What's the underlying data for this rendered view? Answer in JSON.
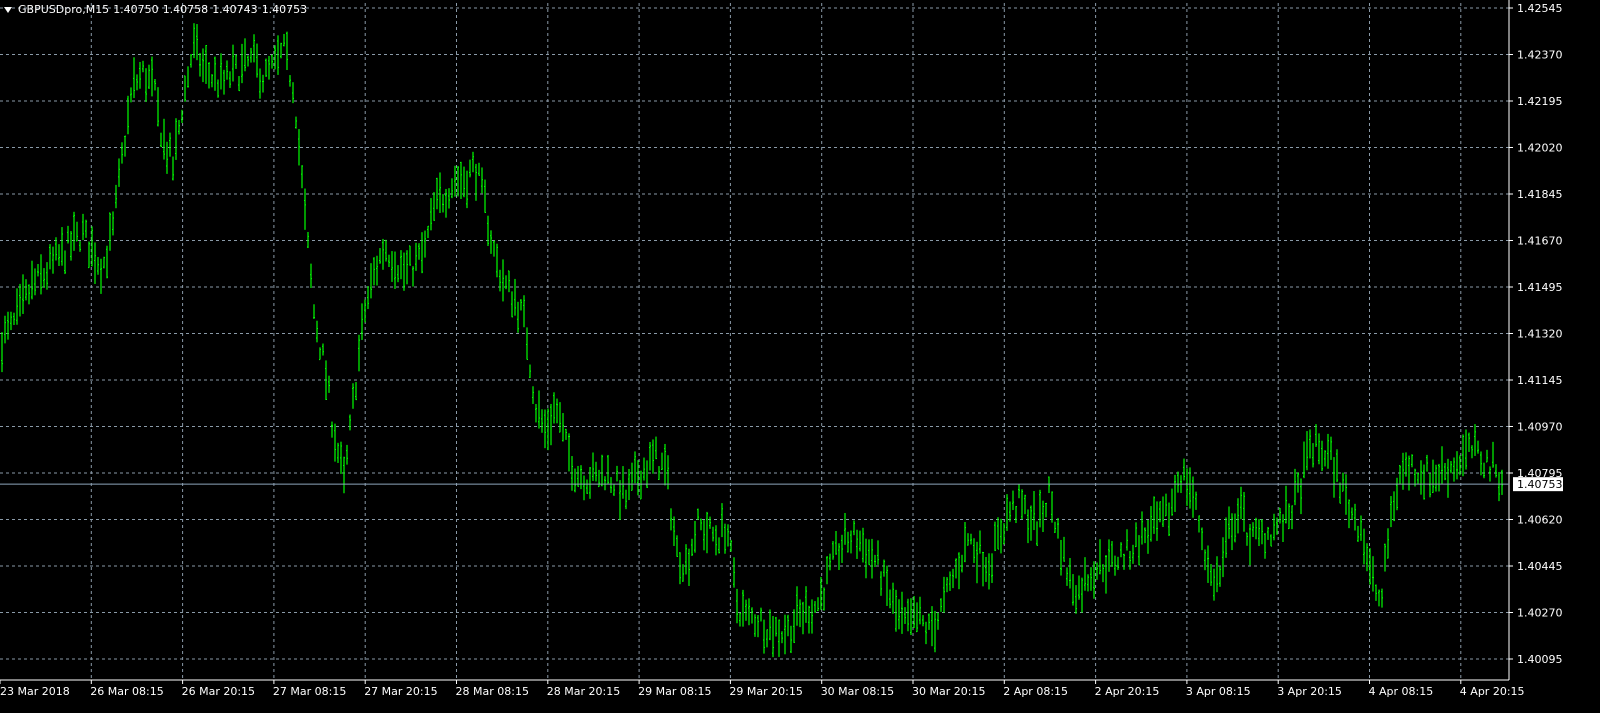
{
  "header": {
    "symbol": "GBPUSDpro,M15",
    "open": "1.40750",
    "high": "1.40758",
    "low": "1.40743",
    "close": "1.40753"
  },
  "colors": {
    "background": "#000000",
    "bars": "#00ff00",
    "grid": "#8a9aa8",
    "axis": "#ffffff",
    "text": "#ffffff",
    "price_line": "#8ea6bd",
    "price_label_bg": "#ffffff",
    "price_label_text": "#000000"
  },
  "current_price": "1.40753",
  "chart_data": {
    "type": "bar",
    "title": "GBPUSDpro,M15",
    "grid": true,
    "y_ticks": [
      "1.42545",
      "1.42370",
      "1.42195",
      "1.42020",
      "1.41845",
      "1.41670",
      "1.41495",
      "1.41320",
      "1.41145",
      "1.40970",
      "1.40795",
      "1.40620",
      "1.40445",
      "1.40270",
      "1.40095"
    ],
    "x_ticks": [
      "23 Mar 2018",
      "26 Mar 08:15",
      "26 Mar 20:15",
      "27 Mar 08:15",
      "27 Mar 20:15",
      "28 Mar 08:15",
      "28 Mar 20:15",
      "29 Mar 08:15",
      "29 Mar 20:15",
      "30 Mar 08:15",
      "30 Mar 20:15",
      "2 Apr 08:15",
      "2 Apr 20:15",
      "3 Apr 08:15",
      "3 Apr 20:15",
      "4 Apr 08:15",
      "4 Apr 20:15"
    ],
    "ylim": [
      1.40095,
      1.42545
    ],
    "series": [
      {
        "values": [
          1.413,
          1.4134,
          1.4142,
          1.415,
          1.4153,
          1.4158,
          1.4162,
          1.4166,
          1.417,
          1.4163,
          1.4157,
          1.417,
          1.42,
          1.4225,
          1.423,
          1.4225,
          1.4205,
          1.4195,
          1.422,
          1.424,
          1.4232,
          1.4228,
          1.4226,
          1.423,
          1.4232,
          1.4235,
          1.4228,
          1.4232,
          1.4238,
          1.4225,
          1.418,
          1.414,
          1.412,
          1.4095,
          1.4075,
          1.411,
          1.414,
          1.4155,
          1.4165,
          1.416,
          1.4155,
          1.4158,
          1.4163,
          1.418,
          1.4185,
          1.419,
          1.419,
          1.4195,
          1.418,
          1.416,
          1.415,
          1.4145,
          1.4135,
          1.4105,
          1.4095,
          1.4105,
          1.409,
          1.408,
          1.4078,
          1.4078,
          1.408,
          1.4075,
          1.407,
          1.4078,
          1.4082,
          1.4085,
          1.408,
          1.405,
          1.4045,
          1.406,
          1.4058,
          1.4055,
          1.406,
          1.403,
          1.4025,
          1.4025,
          1.4022,
          1.402,
          1.402,
          1.4025,
          1.4028,
          1.403,
          1.404,
          1.405,
          1.4055,
          1.4055,
          1.405,
          1.4045,
          1.4035,
          1.4025,
          1.4022,
          1.4025,
          1.402,
          1.4025,
          1.4035,
          1.4045,
          1.4055,
          1.405,
          1.4045,
          1.4055,
          1.4065,
          1.4068,
          1.4063,
          1.406,
          1.4072,
          1.4055,
          1.404,
          1.4035,
          1.4042,
          1.4045,
          1.4045,
          1.4048,
          1.405,
          1.4055,
          1.4058,
          1.406,
          1.4065,
          1.408,
          1.4075,
          1.406,
          1.404,
          1.404,
          1.406,
          1.4065,
          1.4055,
          1.4055,
          1.4058,
          1.406,
          1.4065,
          1.4075,
          1.409,
          1.4088,
          1.4085,
          1.4075,
          1.4065,
          1.406,
          1.404,
          1.403,
          1.4065,
          1.408,
          1.4082,
          1.408,
          1.4078,
          1.408,
          1.4082,
          1.4085,
          1.4088,
          1.4085,
          1.4082,
          1.4078
        ]
      }
    ]
  }
}
